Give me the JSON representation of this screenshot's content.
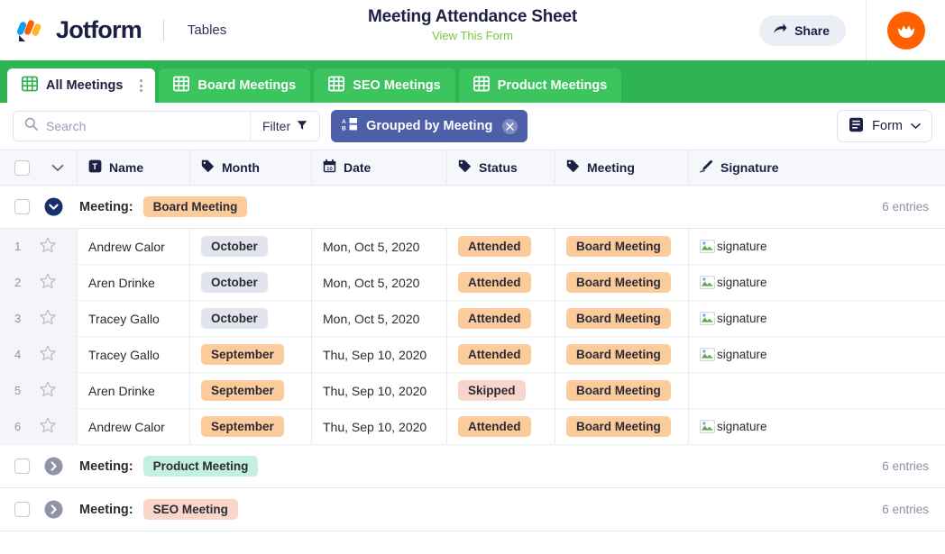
{
  "header": {
    "brand": "Jotform",
    "product": "Tables",
    "title": "Meeting Attendance Sheet",
    "subtitle": "View This Form",
    "share_label": "Share",
    "logo_icon": "jotform-logo-icon",
    "share_icon": "share-arrow-icon",
    "avatar_icon": "user-avatar-icon",
    "accent_green": "#2eb552",
    "title_color": "#1c2045",
    "subtitle_color": "#7bc540",
    "avatar_color": "#ff6100"
  },
  "tabs": [
    {
      "label": "All Meetings",
      "icon": "table-grid-icon",
      "active": true,
      "menu_icon": "more-vertical-icon"
    },
    {
      "label": "Board Meetings",
      "icon": "table-grid-icon",
      "active": false
    },
    {
      "label": "SEO Meetings",
      "icon": "table-grid-icon",
      "active": false
    },
    {
      "label": "Product Meetings",
      "icon": "table-grid-icon",
      "active": false
    }
  ],
  "toolbar": {
    "search_placeholder": "Search",
    "search_value": "",
    "search_icon": "search-icon",
    "filter_label": "Filter",
    "filter_icon": "funnel-icon",
    "group_label": "Grouped by Meeting",
    "group_icon": "sort-az-group-icon",
    "group_close_icon": "close-icon",
    "group_color": "#4c5fa8",
    "form_label": "Form",
    "form_icon": "form-document-icon",
    "form_chevron_icon": "chevron-down-icon"
  },
  "columns": [
    {
      "label": "Name",
      "icon": "textbox-icon"
    },
    {
      "label": "Month",
      "icon": "tag-icon"
    },
    {
      "label": "Date",
      "icon": "calendar-icon"
    },
    {
      "label": "Status",
      "icon": "tag-icon"
    },
    {
      "label": "Meeting",
      "icon": "tag-icon"
    },
    {
      "label": "Signature",
      "icon": "signature-pen-icon"
    }
  ],
  "header_row": {
    "select_all_icon": "checkbox-icon",
    "chevron_icon": "chevron-down-icon"
  },
  "groups": [
    {
      "prefix": "Meeting:",
      "value": "Board Meeting",
      "tag_style": "tag-peach",
      "count": "6 entries",
      "expanded": true,
      "toggle_icon": "chevron-down-circle-icon",
      "rows": [
        {
          "num": "1",
          "name": "Andrew Calor",
          "month": "October",
          "month_style": "tag-gray",
          "date": "Mon, Oct 5, 2020",
          "status": "Attended",
          "status_style": "tag-peach",
          "meeting": "Board Meeting",
          "meeting_style": "tag-peach",
          "signature": "signature"
        },
        {
          "num": "2",
          "name": "Aren Drinke",
          "month": "October",
          "month_style": "tag-gray",
          "date": "Mon, Oct 5, 2020",
          "status": "Attended",
          "status_style": "tag-peach",
          "meeting": "Board Meeting",
          "meeting_style": "tag-peach",
          "signature": "signature"
        },
        {
          "num": "3",
          "name": "Tracey Gallo",
          "month": "October",
          "month_style": "tag-gray",
          "date": "Mon, Oct 5, 2020",
          "status": "Attended",
          "status_style": "tag-peach",
          "meeting": "Board Meeting",
          "meeting_style": "tag-peach",
          "signature": "signature"
        },
        {
          "num": "4",
          "name": "Tracey Gallo",
          "month": "September",
          "month_style": "tag-peach",
          "date": "Thu, Sep 10, 2020",
          "status": "Attended",
          "status_style": "tag-peach",
          "meeting": "Board Meeting",
          "meeting_style": "tag-peach",
          "signature": "signature"
        },
        {
          "num": "5",
          "name": "Aren Drinke",
          "month": "September",
          "month_style": "tag-peach",
          "date": "Thu, Sep 10, 2020",
          "status": "Skipped",
          "status_style": "tag-pink",
          "meeting": "Board Meeting",
          "meeting_style": "tag-peach",
          "signature": ""
        },
        {
          "num": "6",
          "name": "Andrew Calor",
          "month": "September",
          "month_style": "tag-peach",
          "date": "Thu, Sep 10, 2020",
          "status": "Attended",
          "status_style": "tag-peach",
          "meeting": "Board Meeting",
          "meeting_style": "tag-peach",
          "signature": "signature"
        }
      ]
    },
    {
      "prefix": "Meeting:",
      "value": "Product Meeting",
      "tag_style": "tag-mint",
      "count": "6 entries",
      "expanded": false,
      "toggle_icon": "chevron-right-circle-icon",
      "rows": []
    },
    {
      "prefix": "Meeting:",
      "value": "SEO Meeting",
      "tag_style": "tag-salmon",
      "count": "6 entries",
      "expanded": false,
      "toggle_icon": "chevron-right-circle-icon",
      "rows": []
    }
  ]
}
